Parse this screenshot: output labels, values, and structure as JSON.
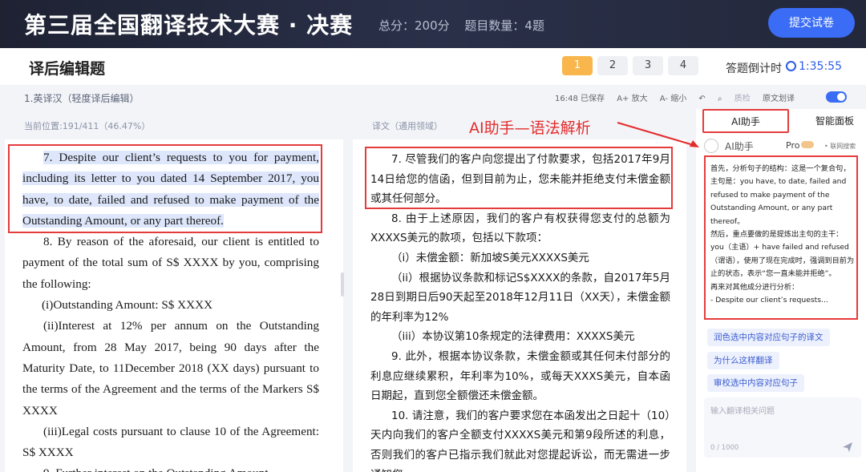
{
  "banner": {
    "title": "第三届全国翻译技术大赛 · 决赛",
    "score": "总分：200分",
    "count": "题目数量：4题",
    "submit": "提交试卷"
  },
  "header": {
    "title": "译后编辑题",
    "questions": [
      "1",
      "2",
      "3",
      "4"
    ],
    "timer_label": "答题倒计时",
    "timer_value": "1:35:55"
  },
  "taskbar": {
    "name": "1.英译汉（轻度译后编辑）",
    "saved": "16:48 已保存",
    "zoom_in": "A+ 放大",
    "zoom_out": "A- 缩小",
    "qa": "质检",
    "line_toggle": "原文划译"
  },
  "source": {
    "position": "当前位置:191/411（46.47%）",
    "paragraphs": [
      "7. Despite our client’s requests to you for payment, including its letter to you dated 14 September 2017, you have, to date, failed and refused to make payment of the Outstanding Amount, or any part thereof.",
      "8. By reason of the aforesaid, our client is entitled to payment of the total sum of S$ XXXX by you, comprising the following:",
      "(i)Outstanding Amount: S$ XXXX",
      "(ii)Interest at 12% per annum on the Outstanding Amount, from 28 May 2017, being 90 days after the Maturity Date, to 11December 2018 (XX days) pursuant to the terms of the Agreement and the terms of the Markers S$ XXXX",
      "(iii)Legal costs pursuant to clause 10 of the Agreement: S$ XXXX",
      "9. Further interest on the Outstanding Amount"
    ]
  },
  "target": {
    "label": "译文（通用领域）",
    "partial_top": "”。",
    "paragraphs": [
      "7. 尽管我们的客户向您提出了付款要求，包括2017年9月14日给您的信函，但到目前为止，您未能并拒绝支付未偿金额或其任何部分。",
      "8. 由于上述原因，我们的客户有权获得您支付的总额为XXXXS美元的款项，包括以下款项：",
      "（i）未偿金额：新加坡S美元XXXXS美元",
      "（ii）根据协议条款和标记S$XXXX的条款，自2017年5月28日到期日后90天起至2018年12月11日（XX天），未偿金额的年利率为12%",
      "（iii）本协议第10条规定的法律费用：XXXXS美元",
      "9. 此外，根据本协议条款，未偿金额或其任何未付部分的利息应继续累积，年利率为10%，或每天XXXS美元，自本函日期起，直到您全额偿还未偿金额。",
      "10. 请注意，我们的客户要求您在本函发出之日起十（10）天内向我们的客户全额支付XXXXS美元和第9段所述的利息，否则我们的客户已指示我们就此对您提起诉讼，而无需进一步通知您。"
    ]
  },
  "annotation": "AI助手—语法解析",
  "ai": {
    "tab_ai": "AI助手",
    "tab_board": "智能面板",
    "name": "AI助手",
    "pro": "Pro",
    "net": "• 联网搜索",
    "output": [
      "首先，分析句子的结构：这是一个复合句，主句是：you have, to date, failed and refused to make payment of the Outstanding Amount, or any part thereof。",
      "然后，重点要做的是提炼出主句的主干：you（主语）+ have failed and refused（谓语），使用了现在完成时，强调到目前为止的状态，表示“您一直未能并拒绝”。",
      "再来对其他成分进行分析：",
      "- Despite our client’s requests..."
    ],
    "suggestions": [
      "润色选中内容对应句子的译文",
      "为什么这样翻译",
      "审校选中内容对应句子"
    ],
    "ask_placeholder": "输入翻译相关问题",
    "ask_count": "0 / 1000"
  }
}
